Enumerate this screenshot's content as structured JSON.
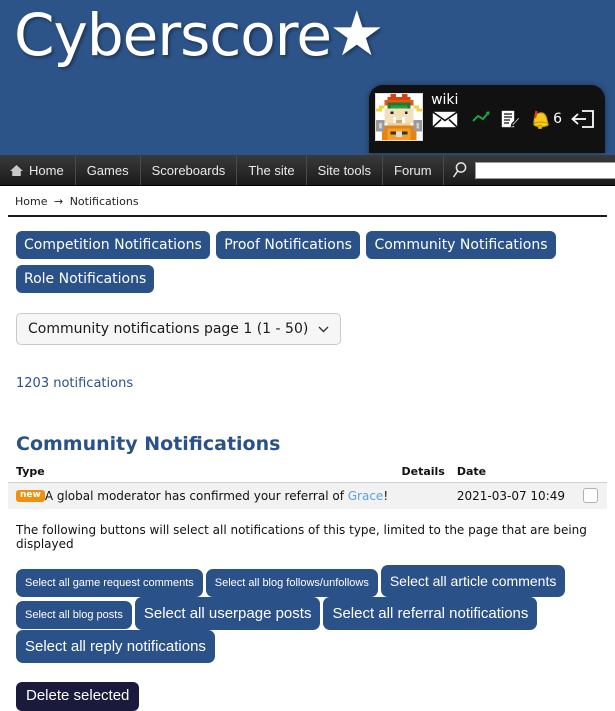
{
  "site": {
    "logo_text": "Cyberscore",
    "logo_star": "★"
  },
  "user_panel": {
    "username": "wiki",
    "avatar_alt": "bowser-avatar",
    "icons": [
      {
        "name": "mail-icon",
        "label": "Messages"
      },
      {
        "name": "chart-icon",
        "label": "Statistics"
      },
      {
        "name": "notepad-icon",
        "label": "Submissions"
      },
      {
        "name": "bell-icon",
        "label": "Notifications"
      },
      {
        "name": "logout-icon",
        "label": "Log out"
      }
    ],
    "bell_count": "6"
  },
  "nav": {
    "items": [
      {
        "label": "Home",
        "icon": "home-icon"
      },
      {
        "label": "Games",
        "icon": ""
      },
      {
        "label": "Scoreboards",
        "icon": ""
      },
      {
        "label": "The site",
        "icon": ""
      },
      {
        "label": "Site tools",
        "icon": ""
      },
      {
        "label": "Forum",
        "icon": ""
      }
    ],
    "search": {
      "value": "",
      "placeholder": "",
      "icon": "search-icon"
    }
  },
  "breadcrumb": {
    "home": "Home",
    "separator": "→",
    "current": "Notifications"
  },
  "tabs": [
    {
      "label": "Competition Notifications"
    },
    {
      "label": "Proof Notifications"
    },
    {
      "label": "Community Notifications"
    },
    {
      "label": "Role Notifications"
    }
  ],
  "page_selector": {
    "label": "Community notifications page 1 (1 - 50)",
    "chevron": "⌄"
  },
  "notification_count": "1203 notifications",
  "section": {
    "title": "Community Notifications"
  },
  "table": {
    "headers": {
      "type": "Type",
      "details": "Details",
      "date": "Date",
      "checkbox": ""
    },
    "rows": [
      {
        "badge": "new",
        "text_before": "A global moderator has confirmed your referral of ",
        "link": "Grace",
        "text_after": "!",
        "details": "",
        "date": "2021-03-07 10:49",
        "checked": false
      }
    ]
  },
  "hint": "The following buttons will select all notifications of this type, limited to the page that are being displayed",
  "select_all_buttons": [
    {
      "label": "Select all game request comments"
    },
    {
      "label": "Select all blog follows/unfollows"
    },
    {
      "label": "Select all article comments"
    },
    {
      "label": "Select all blog posts"
    },
    {
      "label": "Select all userpage posts"
    },
    {
      "label": "Select all referral notifications"
    },
    {
      "label": "Select all reply notifications"
    }
  ],
  "delete_button": {
    "label": "Delete selected"
  },
  "colors": {
    "header_blue": "#2d5488",
    "button_blue": "#2a5288",
    "badge_orange": "#f0900f",
    "link_blue": "#5ba3e0",
    "delete_navy": "#1a1a3d",
    "nav_dark": "#2b2b2b"
  }
}
